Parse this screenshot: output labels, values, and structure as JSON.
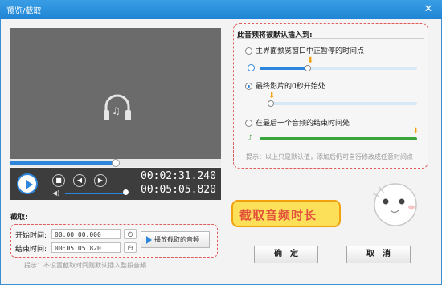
{
  "window": {
    "title": "预览/截取"
  },
  "player": {
    "current_time": "00:02:31.240",
    "total_time": "00:05:05.820",
    "progress": 0.5,
    "volume": 0.95
  },
  "insert_panel": {
    "title": "此音频将被默认插入到:",
    "options": [
      {
        "label": "主界面预览窗口中正暂停的时间点",
        "selected": false
      },
      {
        "label": "最终影片的0秒开始处",
        "selected": true
      },
      {
        "label": "在最后一个音频的结束时间处",
        "selected": false
      }
    ],
    "hint": "提示：以上只是默认值，添加后仍可自行修改成任意时间点"
  },
  "callout": {
    "text": "截取音频时长"
  },
  "capture": {
    "label": "截取:",
    "start_label": "开始时间:",
    "start_value": "00:00:00.000",
    "end_label": "结束时间:",
    "end_value": "00:05:05.820",
    "play_button": "播放截取的音频",
    "hint": "提示：不设置截取时间则默认插入整段音频"
  },
  "buttons": {
    "ok": "确　定",
    "cancel": "取　消"
  },
  "colors": {
    "accent": "#2d86db",
    "highlight": "#e25b5b",
    "callout_fill": "#fde05a",
    "green_track": "#3aa53a"
  },
  "icons": [
    "close-icon",
    "headphone-music-icon",
    "play-icon",
    "stop-icon",
    "prev-icon",
    "next-icon",
    "volume-icon",
    "clock-reset-icon",
    "music-note-icon",
    "orange-arrow-icon"
  ]
}
